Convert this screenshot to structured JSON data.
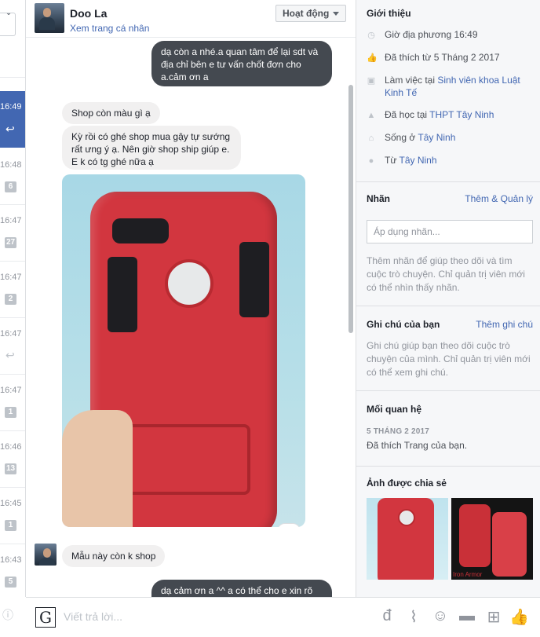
{
  "window": {
    "width": 688,
    "height": 811
  },
  "thread_strip": {
    "items": [
      {
        "time": "16:49",
        "badge": "",
        "active": true,
        "reply": true
      },
      {
        "time": "16:48",
        "badge": "6"
      },
      {
        "time": "16:47",
        "badge": "27"
      },
      {
        "time": "16:47",
        "badge": "2"
      },
      {
        "time": "16:47",
        "badge": "",
        "reply": true
      },
      {
        "time": "16:47",
        "badge": "1"
      },
      {
        "time": "16:46",
        "badge": "13"
      },
      {
        "time": "16:45",
        "badge": "1"
      },
      {
        "time": "16:43",
        "badge": "5"
      }
    ]
  },
  "header": {
    "name": "Doo La",
    "profile_link": "Xem trang cá nhân",
    "activity_button": "Hoạt động"
  },
  "messages": [
    {
      "side": "out",
      "text": "dạ còn a nhé.a quan tâm để lại sdt và địa chỉ bên e tư vấn chốt đơn cho a.cảm ơn a"
    },
    {
      "side": "in",
      "text": "Shop còn màu gì ạ"
    },
    {
      "side": "in",
      "text": "Kỳ rồi có ghé shop mua gậy tự sướng rất ưng ý ạ. Nên giờ shop ship giúp e. E k có tg ghé nữa ạ"
    },
    {
      "side": "in",
      "type": "photo",
      "alt": "red-phone-case-photo"
    },
    {
      "side": "in",
      "text": "Mẫu này còn k shop"
    },
    {
      "side": "out",
      "text": "dạ cảm ơn a ^^ a có thể cho e xin rõ"
    }
  ],
  "composer": {
    "placeholder": "Viết trả lời..."
  },
  "panel": {
    "intro": {
      "title": "Giới thiệu",
      "rows": [
        {
          "icon": "clock-icon",
          "text": "Giờ địa phương 16:49",
          "link": ""
        },
        {
          "icon": "thumbs-up-icon",
          "text": "Đã thích từ 5 Tháng 2 2017",
          "link": ""
        },
        {
          "icon": "briefcase-icon",
          "text": "Làm việc tại ",
          "link": "Sinh viên khoa Luật Kinh Tế"
        },
        {
          "icon": "graduation-cap-icon",
          "text": "Đã học tại ",
          "link": "THPT Tây Ninh"
        },
        {
          "icon": "home-icon",
          "text": "Sống ở ",
          "link": "Tây Ninh"
        },
        {
          "icon": "location-pin-icon",
          "text": "Từ ",
          "link": "Tây Ninh"
        }
      ]
    },
    "labels": {
      "title": "Nhãn",
      "link": "Thêm & Quản lý",
      "placeholder": "Áp dụng nhãn...",
      "help": "Thêm nhãn để giúp theo dõi và tìm cuộc trò chuyện. Chỉ quản trị viên mới có thể nhìn thấy nhãn."
    },
    "notes": {
      "title": "Ghi chú của bạn",
      "link": "Thêm ghi chú",
      "help": "Ghi chú giúp bạn theo dõi cuộc trò chuyện của mình. Chỉ quản trị viên mới có thể xem ghi chú."
    },
    "relationship": {
      "title": "Mối quan hệ",
      "date": "5 THÁNG 2 2017",
      "text": "Đã thích Trang của bạn."
    },
    "shared_photos": {
      "title": "Ảnh được chia sẻ",
      "watermark": "Iron Armor"
    }
  },
  "colors": {
    "accent": "#4267b2",
    "bubble_out": "#444950",
    "bubble_in": "#f1f0f0"
  }
}
